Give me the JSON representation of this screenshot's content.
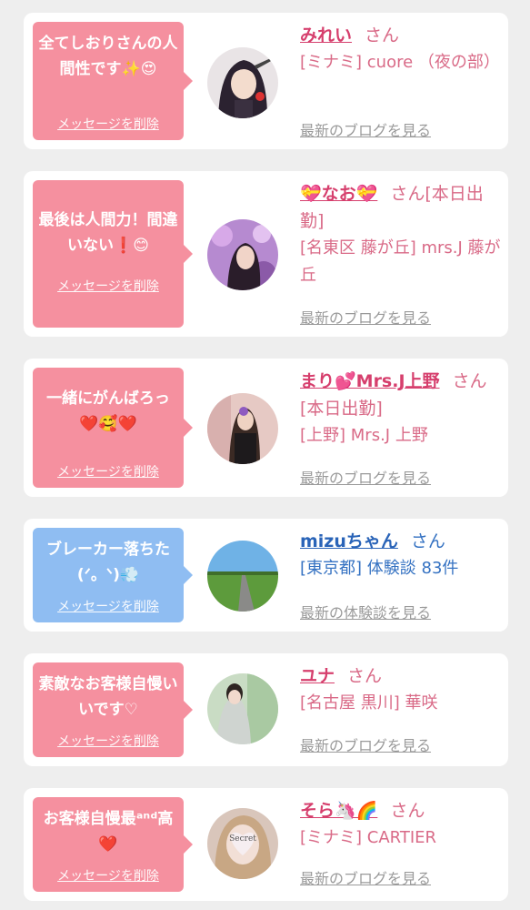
{
  "delete_label": "メッセージを削除",
  "colors": {
    "pink_bubble": "#f5909f",
    "blue_bubble": "#8fbdf2",
    "name_pink": "#d63f6d",
    "name_blue": "#2a64b8"
  },
  "cards": [
    {
      "message": "全てしおりさんの人間性です✨😍",
      "name": "みれい",
      "san": "さん",
      "shop": "[ミナミ] cuore （夜の部）",
      "link": "最新のブログを見る",
      "icon": "avatar-anime-girl"
    },
    {
      "message": "最後は人間力！間違いない❗😊",
      "name": "💝なお💝",
      "san": "さん[本日出勤]",
      "shop": "[名東区 藤が丘] mrs.J 藤が丘",
      "link": "最新のブログを見る",
      "icon": "avatar-woman-purple-flowers"
    },
    {
      "message": "一緒にがんばろっ❤️🥰❤️",
      "name": "まり💕Mrs.J上野",
      "san": "さん[本日出勤]",
      "shop": "[上野] Mrs.J 上野",
      "link": "最新のブログを見る",
      "icon": "avatar-woman-dark-dress"
    },
    {
      "message": "ブレーカー落ちた(ᐟ。ᐠ)💨",
      "name": "mizuちゃん",
      "san": "さん",
      "shop": "[東京都] 体験談 83件",
      "link": "最新の体験談を見る",
      "icon": "avatar-road-landscape"
    },
    {
      "message": "素敵なお客様自慢いいです♡",
      "name": "ユナ",
      "san": "さん",
      "shop": "[名古屋 黒川] 華咲",
      "link": "最新のブログを見る",
      "icon": "avatar-woman-window"
    },
    {
      "message": "お客様自慢最ᵃⁿᵈ高❤️",
      "name": "そら🦄🌈",
      "san": "さん",
      "shop": "[ミナミ] CARTIER",
      "link": "最新のブログを見る",
      "icon": "avatar-woman-secret-heart"
    }
  ]
}
